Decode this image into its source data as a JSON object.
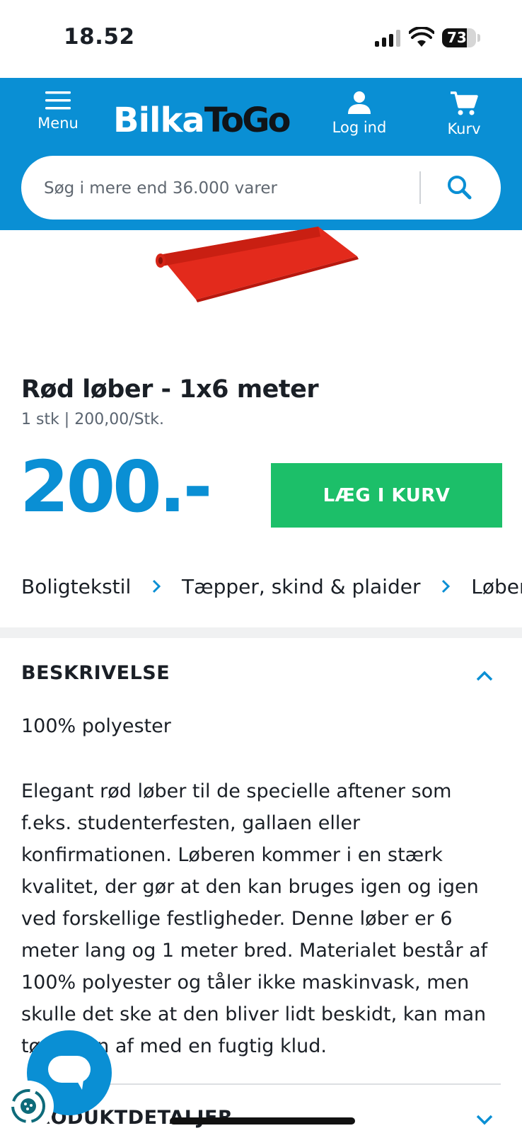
{
  "status_bar": {
    "time": "18.52",
    "battery": "73",
    "battery_level": 0.73
  },
  "header": {
    "menu_label": "Menu",
    "logo_part1": "Bilka",
    "logo_part2": "ToGo",
    "login_label": "Log ind",
    "cart_label": "Kurv",
    "brand_color": "#0a8fd4"
  },
  "search": {
    "placeholder": "Søg i mere end 36.000 varer",
    "icon": "search-icon"
  },
  "product": {
    "title": "Rød løber - 1x6 meter",
    "unit_info": "1 stk | 200,00/Stk.",
    "price": "200.-",
    "add_to_cart_label": "LÆG I KURV",
    "add_to_cart_color": "#1cbf69"
  },
  "breadcrumb": [
    {
      "label": "Boligtekstil"
    },
    {
      "label": "Tæpper, skind & plaider"
    },
    {
      "label": "Løbere"
    }
  ],
  "description": {
    "heading": "BESKRIVELSE",
    "short": "100% polyester",
    "long": "Elegant rød løber til de specielle aftener som f.eks. studenterfesten, gallaen eller konfirmationen. Løberen kommer i en stærk kvalitet, der gør at den kan bruges igen og igen ved forskellige festligheder. Denne løber er 6 meter lang og 1 meter bred. Materialet består af 100% polyester og tåler ikke maskinvask, men skulle det ske at den bliver lidt beskidt, kan man tørre den af med en fugtig klud."
  },
  "product_details": {
    "heading": "PRODUKTDETALJER"
  }
}
